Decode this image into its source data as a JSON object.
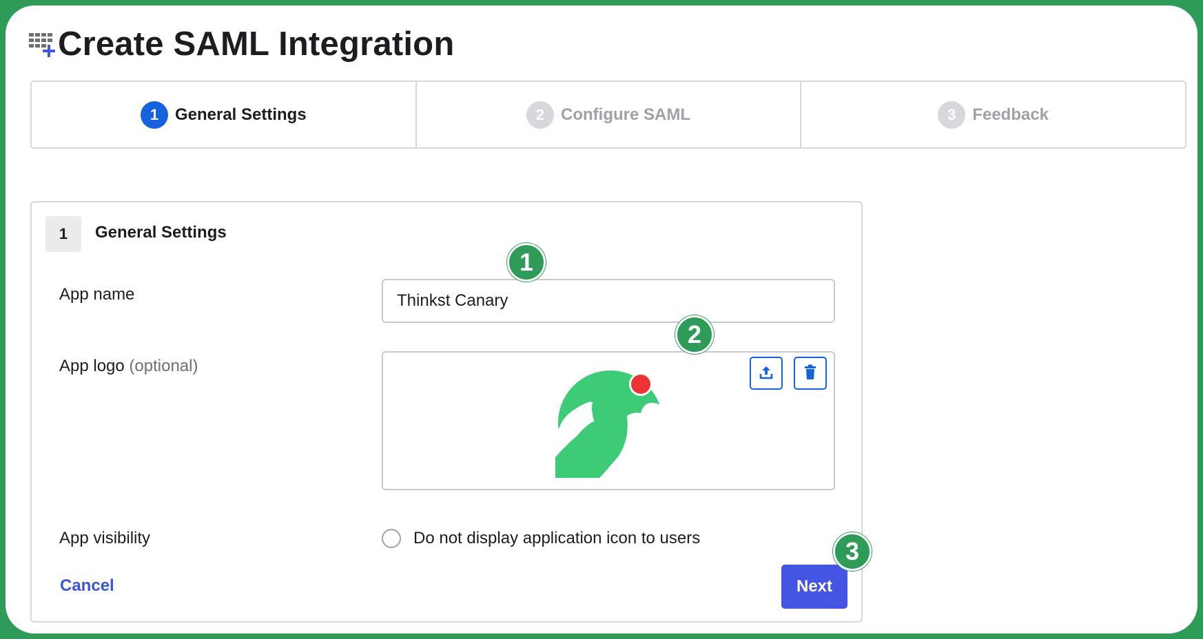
{
  "page": {
    "title": "Create SAML Integration"
  },
  "stepper": {
    "steps": [
      {
        "num": "1",
        "label": "General Settings",
        "state": "active"
      },
      {
        "num": "2",
        "label": "Configure SAML",
        "state": "inactive"
      },
      {
        "num": "3",
        "label": "Feedback",
        "state": "inactive"
      }
    ]
  },
  "section": {
    "num": "1",
    "title": "General Settings"
  },
  "form": {
    "app_name_label": "App name",
    "app_name_value": "Thinkst Canary",
    "app_logo_label": "App logo",
    "app_logo_optional": "(optional)",
    "app_visibility_label": "App visibility",
    "visibility_checkbox_label": "Do not display application icon to users",
    "visibility_checked": false
  },
  "actions": {
    "cancel_label": "Cancel",
    "next_label": "Next"
  },
  "callouts": [
    "1",
    "2",
    "3"
  ],
  "icons": {
    "title": "app-grid-add-icon",
    "upload": "upload-icon",
    "delete": "trash-icon",
    "logo": "canary-logo"
  },
  "colors": {
    "frame": "#2e9b58",
    "accent_blue": "#1662dd",
    "button": "#4455e4",
    "link": "#3b55d9",
    "logo_green": "#3ecb78",
    "logo_red": "#ee3335"
  }
}
